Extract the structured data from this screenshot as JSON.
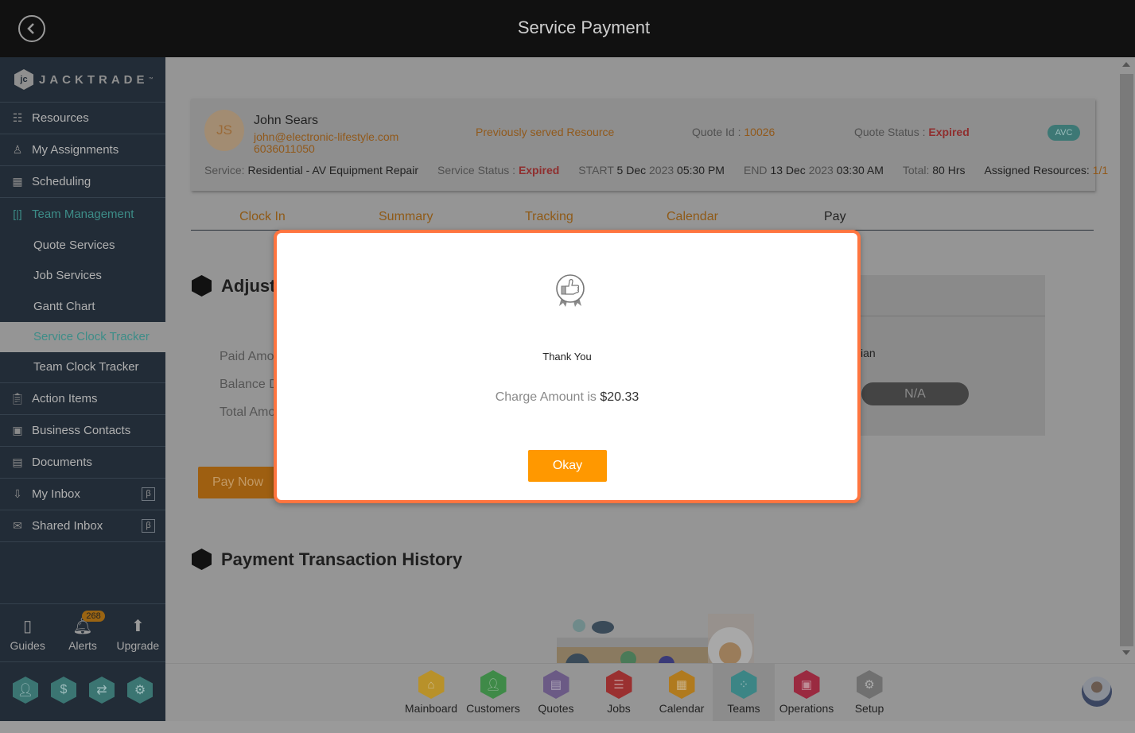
{
  "header": {
    "title": "Service Payment"
  },
  "brand": {
    "name": "JACKTRADE",
    "tm": "™"
  },
  "sidebar": {
    "items": [
      {
        "label": "Resources",
        "icon": "resources-icon"
      },
      {
        "label": "My Assignments",
        "icon": "assignments-icon"
      },
      {
        "label": "Scheduling",
        "icon": "scheduling-icon"
      },
      {
        "label": "Team Management",
        "icon": "team-management-icon"
      }
    ],
    "sub_items": [
      {
        "label": "Quote Services"
      },
      {
        "label": "Job Services"
      },
      {
        "label": "Gantt Chart"
      },
      {
        "label": "Service Clock Tracker"
      },
      {
        "label": "Team Clock Tracker"
      }
    ],
    "items2": [
      {
        "label": "Action Items",
        "icon": "clipboard-icon"
      },
      {
        "label": "Business Contacts",
        "icon": "contacts-icon"
      },
      {
        "label": "Documents",
        "icon": "document-icon"
      },
      {
        "label": "My Inbox",
        "icon": "inbox-icon",
        "badge": "β"
      },
      {
        "label": "Shared Inbox",
        "icon": "mail-icon",
        "badge": "β"
      }
    ],
    "utilities": [
      {
        "label": "Guides"
      },
      {
        "label": "Alerts",
        "count": "268"
      },
      {
        "label": "Upgrade"
      }
    ],
    "quick_actions": [
      "profile",
      "billing",
      "payments",
      "workflow"
    ]
  },
  "customer": {
    "initials": "JS",
    "name": "John Sears",
    "email": "john@electronic-lifestyle.com",
    "phone": "6036011050",
    "resource_note": "Previously served Resource",
    "quote_id_label": "Quote Id : ",
    "quote_id": "10026",
    "quote_status_label": "Quote Status : ",
    "quote_status": "Expired",
    "tag": "AVC",
    "service_label": "Service: ",
    "service": "Residential - AV Equipment Repair",
    "service_status_label": "Service Status : ",
    "service_status": "Expired",
    "start_label": "START ",
    "start_day": "5 Dec ",
    "start_year": "2023",
    "start_time": " 05:30 PM",
    "end_label": "END ",
    "end_day": "13 Dec ",
    "end_year": "2023",
    "end_time": " 03:30 AM",
    "total_label": "Total: ",
    "total": "80 Hrs",
    "assigned_label": "Assigned Resources: ",
    "assigned": "1/1"
  },
  "tabs": [
    {
      "label": "Clock In"
    },
    {
      "label": "Summary"
    },
    {
      "label": "Tracking"
    },
    {
      "label": "Calendar"
    },
    {
      "label": "Pay",
      "active": true
    }
  ],
  "adjust": {
    "title": "Adjust",
    "paid_label": "Paid Amo",
    "balance_label": "Balance D",
    "total_label": "Total Amo",
    "pay_now": "Pay Now",
    "right_text": "ian",
    "na_value": "N/A"
  },
  "history": {
    "title": "Payment Transaction History"
  },
  "apps": [
    {
      "label": "Mainboard",
      "color": "#b8912a"
    },
    {
      "label": "Customers",
      "color": "#3f8a48"
    },
    {
      "label": "Quotes",
      "color": "#6b5a85"
    },
    {
      "label": "Jobs",
      "color": "#9a3030"
    },
    {
      "label": "Calendar",
      "color": "#b07a1e"
    },
    {
      "label": "Teams",
      "color": "#3c8585",
      "active": true
    },
    {
      "label": "Operations",
      "color": "#9a2a40"
    },
    {
      "label": "Setup",
      "color": "#707070"
    }
  ],
  "modal": {
    "title": "Thank You",
    "charge_label": "Charge Amount is ",
    "charge_amount": "$20.33",
    "okay": "Okay"
  }
}
